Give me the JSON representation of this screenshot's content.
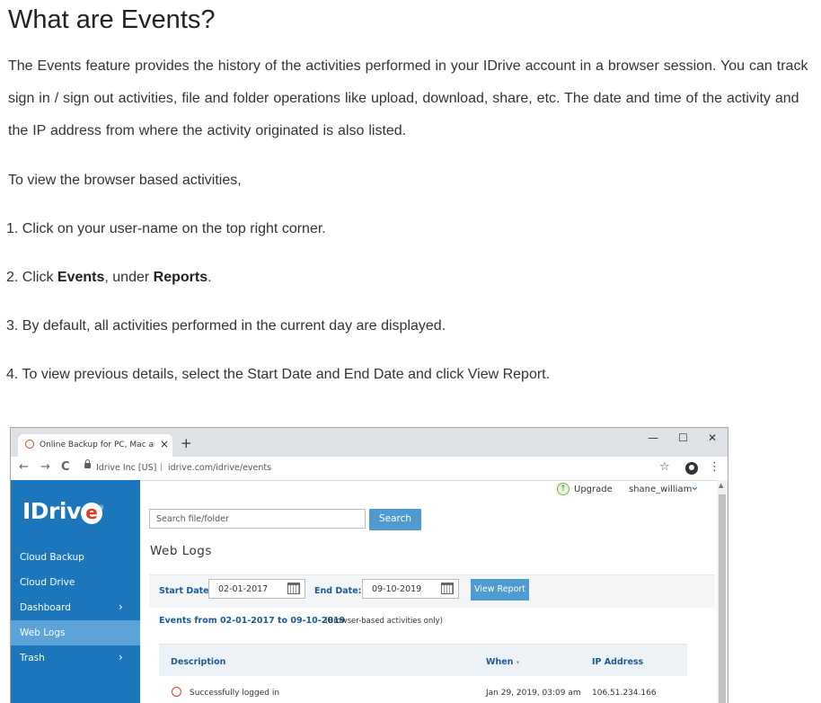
{
  "article": {
    "title": "What are Events?",
    "intro": "The Events feature provides the history of the activities performed in your IDrive account in a browser session. You can track sign in / sign out activities, file and folder operations like upload, download, share, etc. The date and time of the activity and the IP address from where the activity originated is also listed.",
    "lead": "To view the browser based activities,",
    "step1": "1. Click on your user-name on the top right corner.",
    "step2_prefix": "2. Click ",
    "step2_events": "Events",
    "step2_mid": ", under ",
    "step2_reports": "Reports",
    "step2_suffix": ".",
    "step3": "3. By default, all activities performed in the current day are displayed.",
    "step4": "4. To view previous details, select the Start Date and End Date and click View Report."
  },
  "browser": {
    "tab_title": "Online Backup for PC, Mac and iPhone",
    "tab_close": "×",
    "new_tab": "+",
    "win_min": "—",
    "win_max": "☐",
    "win_close": "✕",
    "nav_back": "←",
    "nav_forward": "→",
    "nav_reload": "C",
    "url_site": "Idrive Inc [US]",
    "url_sep": "|",
    "url_path": "idrive.com/idrive/events",
    "star": "☆",
    "kebab": "⋮"
  },
  "app": {
    "logo_text": "IDriv",
    "logo_e": "e",
    "logo_reg": "®",
    "upgrade_label": "Upgrade",
    "user_name": "shane_william",
    "user_chevron": "⌄",
    "sidebar": [
      {
        "label": "Cloud Backup",
        "chevron": ""
      },
      {
        "label": "Cloud Drive",
        "chevron": ""
      },
      {
        "label": "Dashboard",
        "chevron": "›"
      },
      {
        "label": "Web Logs",
        "chevron": ""
      },
      {
        "label": "Trash",
        "chevron": "›"
      }
    ],
    "search_placeholder": "Search file/folder",
    "search_button": "Search",
    "section_title": "Web Logs",
    "start_label": "Start Date:",
    "start_value": "02-01-2017",
    "end_label": "End Date:",
    "end_value": "09-10-2019",
    "view_report": "View Report",
    "events_range": "Events from 02-01-2017 to 09-10-2019",
    "events_note": "(Browser-based activities only)",
    "table": {
      "headers": {
        "description": "Description",
        "when": "When",
        "ip": "IP Address"
      },
      "sort_caret": "▾",
      "rows": [
        {
          "description": "Successfully logged in",
          "when": "Jan 29, 2019, 03:09 am",
          "ip": "106.51.234.166"
        }
      ]
    }
  }
}
